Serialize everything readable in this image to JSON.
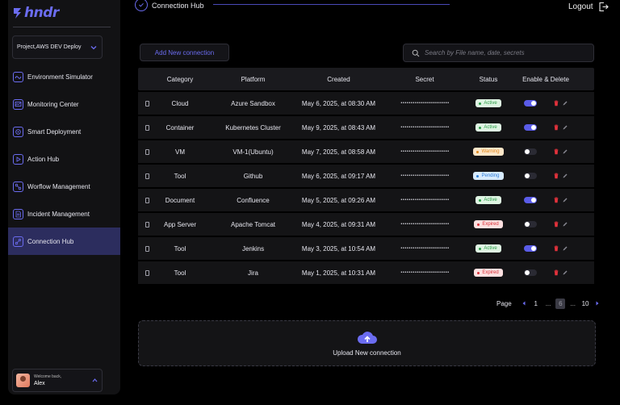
{
  "app": {
    "logo_text": "hndr"
  },
  "sidebar": {
    "project": "Project,AWS DEV Deploy",
    "items": [
      {
        "label": "Environment Simulator",
        "icon": "simulator-icon",
        "active": false
      },
      {
        "label": "Monitoring Center",
        "icon": "monitor-icon",
        "active": false
      },
      {
        "label": "Smart Deployment",
        "icon": "deploy-icon",
        "active": false
      },
      {
        "label": "Action Hub",
        "icon": "play-icon",
        "active": false
      },
      {
        "label": "Worflow Management",
        "icon": "workflow-icon",
        "active": false
      },
      {
        "label": "Incident Management",
        "icon": "document-icon",
        "active": false
      },
      {
        "label": "Connection Hub",
        "icon": "connection-icon",
        "active": true
      }
    ],
    "user": {
      "welcome": "Welcome back,",
      "name": "Alex"
    }
  },
  "header": {
    "title": "Connection Hub",
    "logout": "Logout"
  },
  "toolbar": {
    "add_label": "Add New connection",
    "search_placeholder": "Search by File name, date, secrets"
  },
  "table": {
    "headers": [
      "Category",
      "Platform",
      "Created",
      "Secret",
      "Status",
      "Enable & Delete"
    ],
    "rows": [
      {
        "category": "Cloud",
        "platform": "Azure Sandbox",
        "created": "May 6, 2025, at 08:30 AM",
        "secret": "••••••••••••••••••••••••",
        "status": "Active",
        "enabled": true
      },
      {
        "category": "Container",
        "platform": "Kubernetes Cluster",
        "created": "May 9, 2025, at 08:43 AM",
        "secret": "••••••••••••••••••••••••",
        "status": "Active",
        "enabled": true
      },
      {
        "category": "VM",
        "platform": "VM-1(Ubuntu)",
        "created": "May 7, 2025, at 08:58 AM",
        "secret": "••••••••••••••••••••••••",
        "status": "Warning",
        "enabled": false
      },
      {
        "category": "Tool",
        "platform": "Github",
        "created": "May 6, 2025, at 09:17 AM",
        "secret": "••••••••••••••••••••••••",
        "status": "Pending",
        "enabled": false
      },
      {
        "category": "Document",
        "platform": "Confluence",
        "created": "May 5, 2025, at 09:26 AM",
        "secret": "••••••••••••••••••••••••",
        "status": "Active",
        "enabled": true
      },
      {
        "category": "App Server",
        "platform": "Apache Tomcat",
        "created": "May 4, 2025, at 09:31 AM",
        "secret": "••••••••••••••••••••••••",
        "status": "Expired",
        "enabled": false
      },
      {
        "category": "Tool",
        "platform": "Jenkins",
        "created": "May 3, 2025, at 10:54 AM",
        "secret": "••••••••••••••••••••••••",
        "status": "Active",
        "enabled": true
      },
      {
        "category": "Tool",
        "platform": "Jira",
        "created": "May 1, 2025, at 10:31 AM",
        "secret": "••••••••••••••••••••••••",
        "status": "Expired",
        "enabled": false
      }
    ]
  },
  "status_styles": {
    "Active": {
      "bg": "#dff5e3",
      "fg": "#2e9e4a"
    },
    "Warning": {
      "bg": "#fde6c8",
      "fg": "#e08a1e"
    },
    "Pending": {
      "bg": "#d7ebff",
      "fg": "#2f7fd6"
    },
    "Expired": {
      "bg": "#fde0e0",
      "fg": "#d8323a"
    }
  },
  "pagination": {
    "label": "Page",
    "first": "1",
    "ellipsis": "...",
    "current": "6",
    "last": "10"
  },
  "upload": {
    "label": "Upload New connection"
  },
  "colors": {
    "accent": "#6b6cf0",
    "delete": "#e5323c",
    "sidebar_active": "#2c2d5e"
  }
}
